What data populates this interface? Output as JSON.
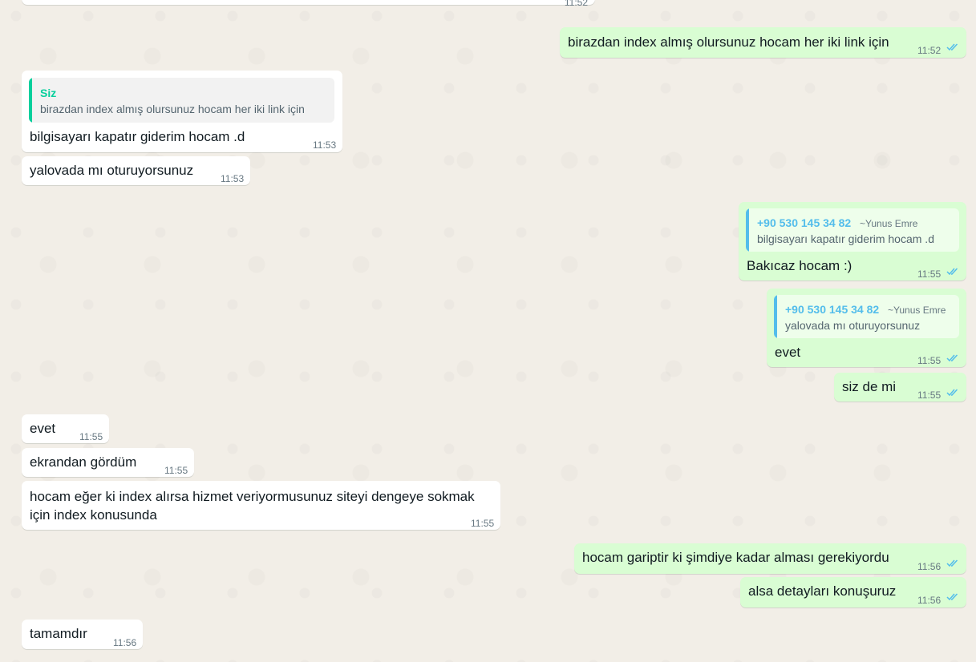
{
  "colors": {
    "chat_background": "#f2eee7",
    "incoming_bubble": "#ffffff",
    "outgoing_bubble": "#d9fdd3",
    "read_ticks": "#53bdeb",
    "quote_self_bar": "#06cf9c",
    "quote_other_bar": "#53bdeb"
  },
  "icons": {
    "read_receipt": "double-check-icon"
  },
  "top_partial": {
    "time": "11:52"
  },
  "messages": [
    {
      "dir": "out",
      "text": "birazdan index almış olursunuz hocam her iki link için",
      "time": "11:52"
    },
    {
      "dir": "in",
      "quote": {
        "author": "Siz",
        "text": "birazdan index almış olursunuz hocam her iki link için"
      },
      "text": "bilgisayarı kapatır giderim hocam .d",
      "time": "11:53"
    },
    {
      "dir": "in",
      "text": "yalovada mı oturuyorsunuz",
      "time": "11:53"
    },
    {
      "dir": "out",
      "quote": {
        "author": "+90 530 145 34 82",
        "pushname": "~Yunus Emre",
        "text": "bilgisayarı kapatır giderim hocam .d"
      },
      "text": "Bakıcaz hocam :)",
      "time": "11:55"
    },
    {
      "dir": "out",
      "quote": {
        "author": "+90 530 145 34 82",
        "pushname": "~Yunus Emre",
        "text": "yalovada mı oturuyorsunuz"
      },
      "text": "evet",
      "time": "11:55"
    },
    {
      "dir": "out",
      "text": "siz de mi",
      "time": "11:55"
    },
    {
      "dir": "in",
      "text": "evet",
      "time": "11:55"
    },
    {
      "dir": "in",
      "text": "ekrandan gördüm",
      "time": "11:55"
    },
    {
      "dir": "in",
      "text_line1": "hocam eğer ki index alırsa hizmet veriyormusunuz siteyi dengeye sokmak",
      "text_line2": "için index konusunda",
      "time": "11:55"
    },
    {
      "dir": "out",
      "text": "hocam gariptir ki şimdiye kadar alması gerekiyordu",
      "time": "11:56"
    },
    {
      "dir": "out",
      "text": "alsa detayları konuşuruz",
      "time": "11:56"
    },
    {
      "dir": "in",
      "text": "tamamdır",
      "time": "11:56"
    }
  ]
}
